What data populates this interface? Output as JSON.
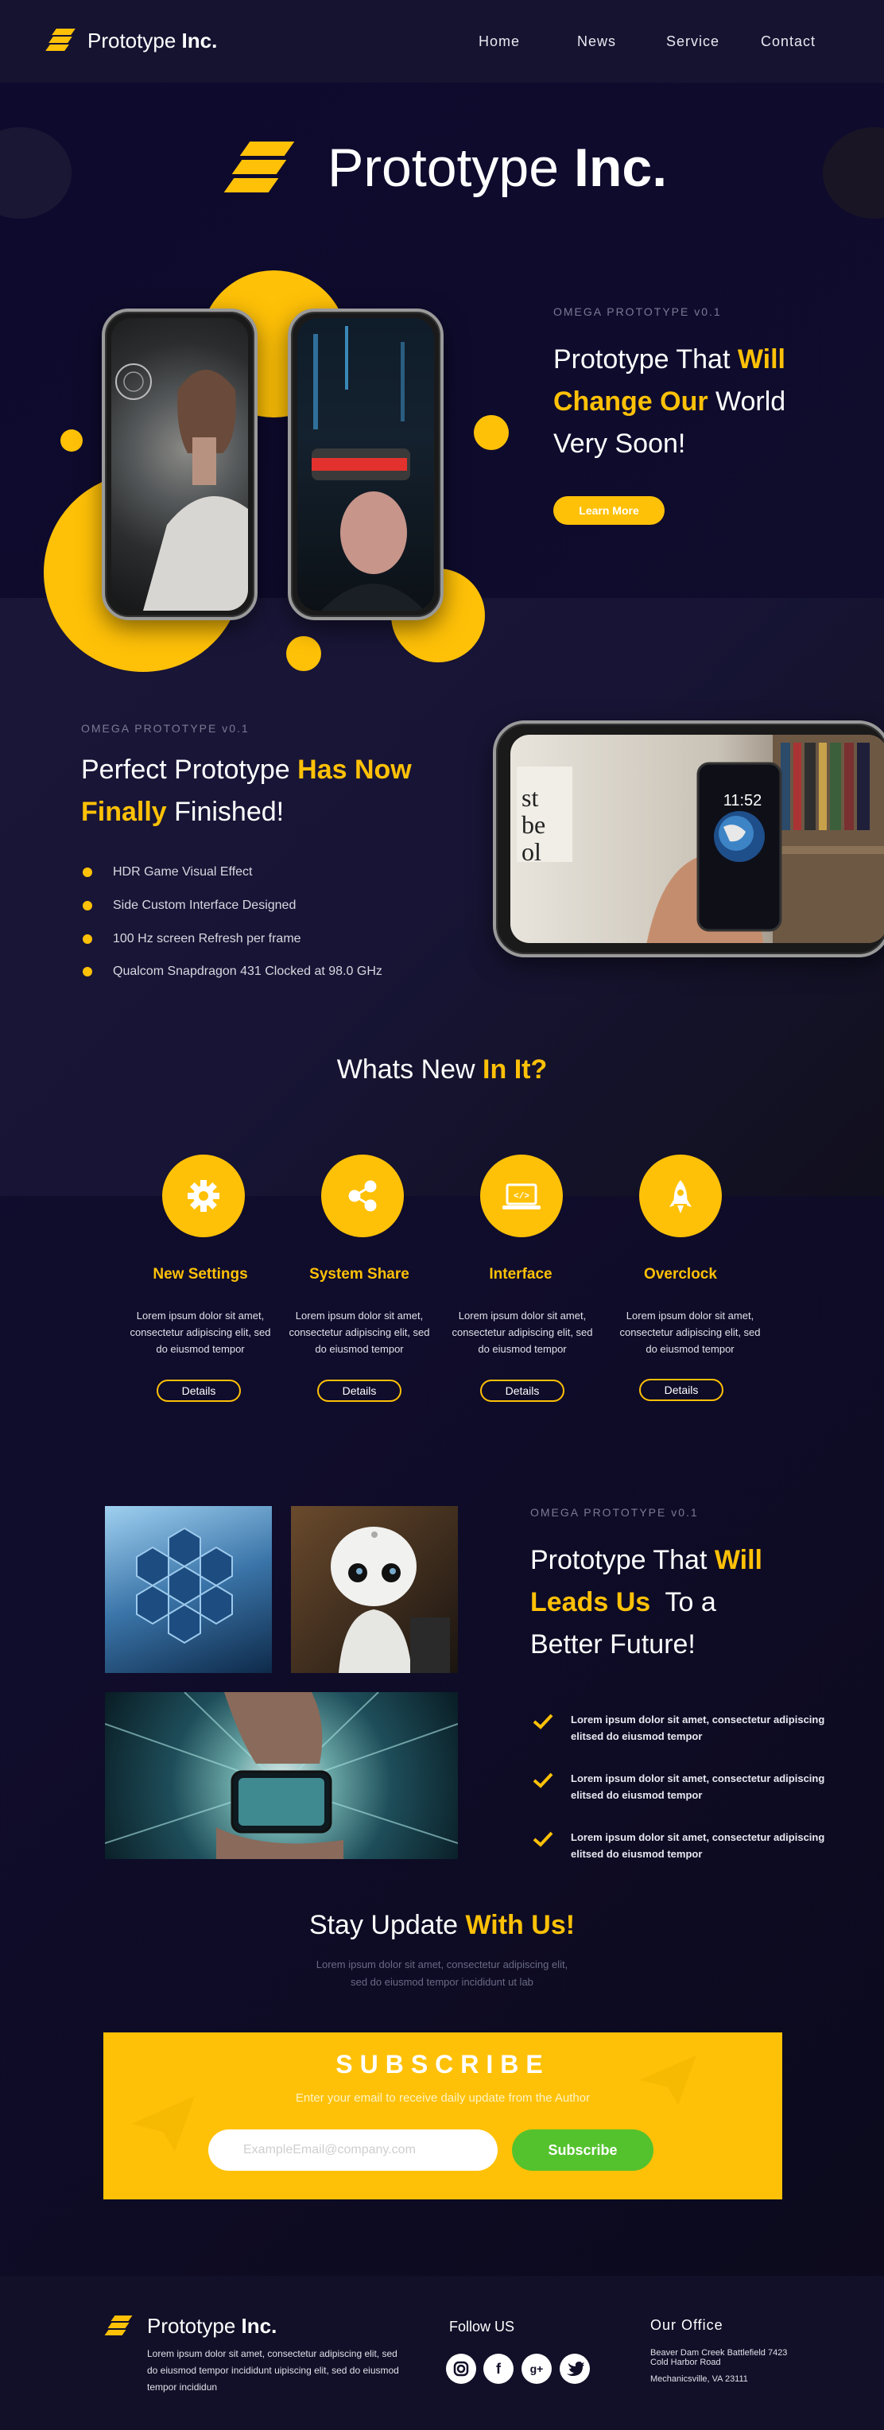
{
  "header": {
    "brand_prefix": "Prototype",
    "brand_bold": "Inc.",
    "nav": [
      "Home",
      "News",
      "Service",
      "Contact"
    ]
  },
  "hero": {
    "title_prefix": "Prototype",
    "title_bold": "Inc.",
    "kicker": "OMEGA PROTOTYPE v0.1",
    "heading_line1_plain": "Prototype That ",
    "heading_line1_yellow": "Will",
    "heading_line2_yellow": "Change Our",
    "heading_line2_plain": " World",
    "heading_line3": "Very Soon!",
    "cta": "Learn More"
  },
  "finished": {
    "kicker": "OMEGA PROTOTYPE v0.1",
    "heading_line1_plain": "Perfect Prototype ",
    "heading_line1_yellow": "Has Now",
    "heading_line2_yellow": "Finally",
    "heading_line2_plain": " Finished!",
    "phone_time": "11:52",
    "bullets": [
      "HDR Game Visual Effect",
      "Side Custom Interface Designed",
      "100 Hz screen Refresh per frame",
      "Qualcom Snapdragon 431 Clocked at 98.0 GHz"
    ]
  },
  "whats_new": {
    "title_plain": "Whats New ",
    "title_yellow": "In It?",
    "features": [
      {
        "icon": "gear-icon",
        "title": "New Settings",
        "desc": "Lorem ipsum dolor sit amet, consectetur adipiscing elit, sed do eiusmod tempor",
        "button": "Details"
      },
      {
        "icon": "share-icon",
        "title": "System Share",
        "desc": "Lorem ipsum dolor sit amet, consectetur adipiscing elit, sed do eiusmod tempor",
        "button": "Details"
      },
      {
        "icon": "laptop-code-icon",
        "title": "Interface",
        "desc": "Lorem ipsum dolor sit amet, consectetur adipiscing elit, sed do eiusmod tempor",
        "button": "Details"
      },
      {
        "icon": "rocket-icon",
        "title": "Overclock",
        "desc": "Lorem ipsum dolor sit amet, consectetur adipiscing elit, sed do eiusmod tempor",
        "button": "Details"
      }
    ]
  },
  "future": {
    "kicker": "OMEGA PROTOTYPE v0.1",
    "heading_line1_plain": "Prototype That ",
    "heading_line1_yellow": "Will",
    "heading_line2_yellow": "Leads Us",
    "heading_line2_plain": "  To a",
    "heading_line3": "Better Future!",
    "checks": [
      "Lorem ipsum dolor sit amet, consectetur adipiscing elitsed do eiusmod tempor",
      "Lorem ipsum dolor sit amet, consectetur adipiscing elitsed do eiusmod tempor",
      "Lorem ipsum dolor sit amet, consectetur adipiscing elitsed do eiusmod tempor"
    ]
  },
  "stay": {
    "title_plain": "Stay Update ",
    "title_yellow": "With Us!",
    "desc_line1": "Lorem ipsum dolor sit amet, consectetur adipiscing elit,",
    "desc_line2": "sed do eiusmod tempor incididunt ut lab"
  },
  "subscribe": {
    "title": "SUBSCRIBE",
    "desc": "Enter your email to receive daily update from the Author",
    "placeholder": "ExampleEmail@company.com",
    "button": "Subscribe"
  },
  "footer": {
    "brand_prefix": "Prototype",
    "brand_bold": "Inc.",
    "about": "Lorem ipsum dolor sit amet, consectetur adipiscing elit, sed do eiusmod tempor incididunt uipiscing elit, sed do eiusmod tempor incididun",
    "follow_title": "Follow US",
    "social": [
      "instagram-icon",
      "facebook-icon",
      "google-plus-icon",
      "twitter-icon"
    ],
    "office_title": "Our Office",
    "office_line1": "Beaver Dam Creek Battlefield 7423",
    "office_line2": "Cold Harbor Road",
    "office_line3": "Mechanicsville, VA 23111"
  },
  "colors": {
    "accent": "#ffc107",
    "background": "#0d0a2e",
    "subscribe_button": "#54c22d"
  }
}
